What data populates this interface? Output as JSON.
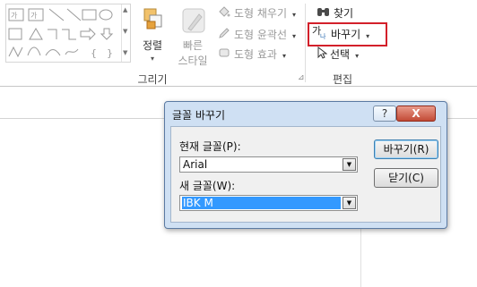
{
  "ribbon": {
    "groups": {
      "drawing": {
        "label": "그리기"
      },
      "editing": {
        "label": "편집"
      }
    },
    "arrange_button": {
      "label": "정렬"
    },
    "quick_styles_button": {
      "label_line1": "빠른",
      "label_line2": "스타일"
    },
    "shape_fill": {
      "label": "도형 채우기"
    },
    "shape_outline": {
      "label": "도형 윤곽선"
    },
    "shape_effects": {
      "label": "도형 효과"
    },
    "find": {
      "label": "찾기"
    },
    "replace": {
      "label": "바꾸기"
    },
    "select": {
      "label": "선택"
    },
    "colors": {
      "highlight": "#d3202a",
      "selection": "#3399ff"
    }
  },
  "dialog": {
    "title": "글꼴 바꾸기",
    "help_label": "?",
    "close_label": "X",
    "current_font_label": "현재 글꼴(P):",
    "current_font_value": "Arial",
    "new_font_label": "새 글꼴(W):",
    "new_font_value": "IBK M",
    "replace_button": "바꾸기(R)",
    "close_button": "닫기(C)"
  }
}
